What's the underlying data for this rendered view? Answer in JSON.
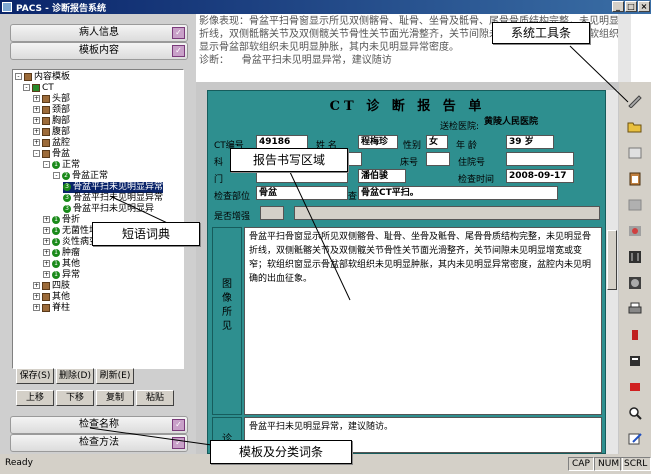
{
  "window": {
    "title": "PACS - 诊断报告系统",
    "min_label": "_",
    "max_label": "□",
    "close_label": "×"
  },
  "sidebar": {
    "categories": {
      "patient_info": "病人信息",
      "template_content": "模板内容",
      "exam_name": "检查名称",
      "exam_method": "检查方法"
    },
    "tree": {
      "root": "内容模板",
      "ct": "CT",
      "head": "头部",
      "neck": "颈部",
      "chest": "胸部",
      "abdomen": "腹部",
      "pelvic_cavity": "盆腔",
      "pelvis": "骨盆",
      "normal": "正常",
      "pelvis_normal": "骨盆正常",
      "phrase1": "骨盆平扫未见明显异常",
      "phrase2": "骨盆平扫未见明显异常",
      "phrase3": "骨盆平扫未见明显异",
      "fracture": "骨折",
      "no_necrosis": "无菌性坏死",
      "inflammation": "炎性病变",
      "tumor": "肿瘤",
      "other": "其他",
      "abnormal": "异常",
      "limbs": "四肢",
      "other2": "其他",
      "spine": "脊柱"
    },
    "buttons": {
      "save": "保存(S)",
      "delete": "删除(D)",
      "refresh": "刷新(E)",
      "up": "上移",
      "down": "下移",
      "copy": "复制",
      "paste": "粘贴"
    }
  },
  "top_text": {
    "findings_label": "影像表现：",
    "findings_text": "骨盆平扫骨窗显示所见双侧髂骨、耻骨、坐骨及骶骨、尾骨骨质结构完整，未见明显骨折线，双侧骶髂关节及双侧髋关节骨性关节面光滑整齐，关节间隙未见明显增宽或变窄；软组织窗显示骨盆部软组织未见明显肿胀，其内未见明显异常密度。",
    "diagnosis_label": "诊断：",
    "diagnosis_text": "骨盆平扫未见明显异常，建议随访"
  },
  "report": {
    "title": "CT 诊 断 报 告 单",
    "hospital_label": "送检医院:",
    "hospital_value": "黄陵人民医院",
    "ct_no_label": "CT编号",
    "ct_no_value": "49186",
    "name_label": "姓  名",
    "name_value": "程梅珍",
    "sex_label": "性别",
    "sex_value": "女",
    "age_label": "年  龄",
    "age_value": "39 岁",
    "dept_label": "科",
    "bed_label": "床号",
    "inpatient_label": "住院号",
    "clinic_label": "门",
    "doctor_value": "潘伯骏",
    "exam_time_label": "检查时间",
    "exam_time_value": "2008-09-17",
    "exam_part_label": "检查部位",
    "exam_part_value": "骨盆",
    "exam_method_label": "查",
    "exam_method_value": "骨盆CT平扫。",
    "enhance_label": "是否增强",
    "findings_side": "图像所见",
    "findings_text": "骨盆平扫骨窗显示所见双侧髂骨、耻骨、坐骨及骶骨、尾骨骨质结构完整，未见明显骨折线，双侧骶髂关节及双侧髋关节骨性关节面光滑整齐，关节间隙未见明显增宽或变窄；软组织窗显示骨盆部软组织未见明显肿胀，其内未见明显异常密度，盆腔内未见明确的出血征象。",
    "diagnosis_side": "诊",
    "diagnosis_text": "骨盆平扫未见明显异常，建议随访。"
  },
  "statusbar": {
    "ready": "Ready",
    "cap": "CAP",
    "num": "NUM",
    "scrl": "SCRL"
  },
  "callouts": {
    "toolbar": "系统工具条",
    "writing_area": "报告书写区域",
    "phrase_dict": "短语词典",
    "template_terms": "模板及分类词条"
  },
  "colors": {
    "report_bg": "#2e8f8f",
    "title_bar": "#0a246a"
  },
  "icons": [
    "pen-icon",
    "folder-open-icon",
    "window-icon",
    "clipboard-icon",
    "grey-square-icon",
    "image-icon",
    "scan-image-icon",
    "printer-icon",
    "red-figure-icon",
    "document-stack-icon",
    "red-stamp-icon",
    "magnifier-icon",
    "edit-icon"
  ]
}
